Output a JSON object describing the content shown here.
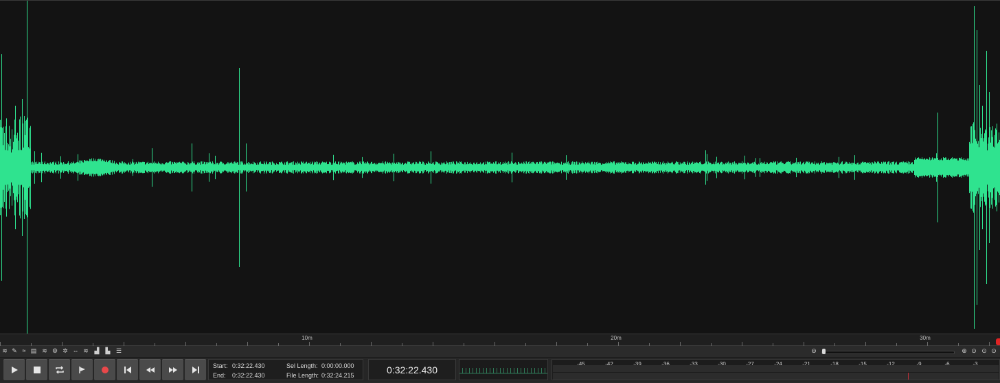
{
  "waveform": {
    "color": "#2fe38f",
    "background": "#131313"
  },
  "ruler": {
    "labels": [
      "10m",
      "20m",
      "30m"
    ]
  },
  "toolbar": {
    "icons": [
      "waveform-view-icon",
      "pencil-icon",
      "waveform-select-icon",
      "spectral-icon",
      "gear-link-icon",
      "spectral-brush-icon",
      "split-icon",
      "waveform-alt-icon",
      "spectrum-icon",
      "bar-graph-icon",
      "list-icon"
    ],
    "zoom_icons": [
      "zoom-out-icon",
      "zoom-in-icon",
      "zoom-selection-icon",
      "zoom-fit-icon",
      "zoom-full-icon"
    ]
  },
  "transport": {
    "buttons": [
      {
        "name": "play-button",
        "icon": "play-icon"
      },
      {
        "name": "stop-button",
        "icon": "stop-icon"
      },
      {
        "name": "loop-button",
        "icon": "loop-icon"
      },
      {
        "name": "cue-button",
        "icon": "flag-icon"
      },
      {
        "name": "record-button",
        "icon": "record-icon"
      },
      {
        "name": "skip-start-button",
        "icon": "skip-back-icon"
      },
      {
        "name": "rewind-button",
        "icon": "rewind-icon"
      },
      {
        "name": "fast-forward-button",
        "icon": "fast-forward-icon"
      },
      {
        "name": "skip-end-button",
        "icon": "skip-forward-icon"
      }
    ],
    "record_color": "#e8484a"
  },
  "info": {
    "start_label": "Start:",
    "start_value": "0:32:22.430",
    "end_label": "End:",
    "end_value": "0:32:22.430",
    "sel_length_label": "Sel Length:",
    "sel_length_value": "0:00:00.000",
    "file_length_label": "File Length:",
    "file_length_value": "0:32:24.215"
  },
  "time_display": "0:32:22.430",
  "meter": {
    "db_labels": [
      "-45",
      "-42",
      "-39",
      "-36",
      "-33",
      "-30",
      "-27",
      "-24",
      "-21",
      "-18",
      "-15",
      "-12",
      "-9",
      "-6",
      "-3"
    ],
    "marker_color": "#c0303a"
  }
}
